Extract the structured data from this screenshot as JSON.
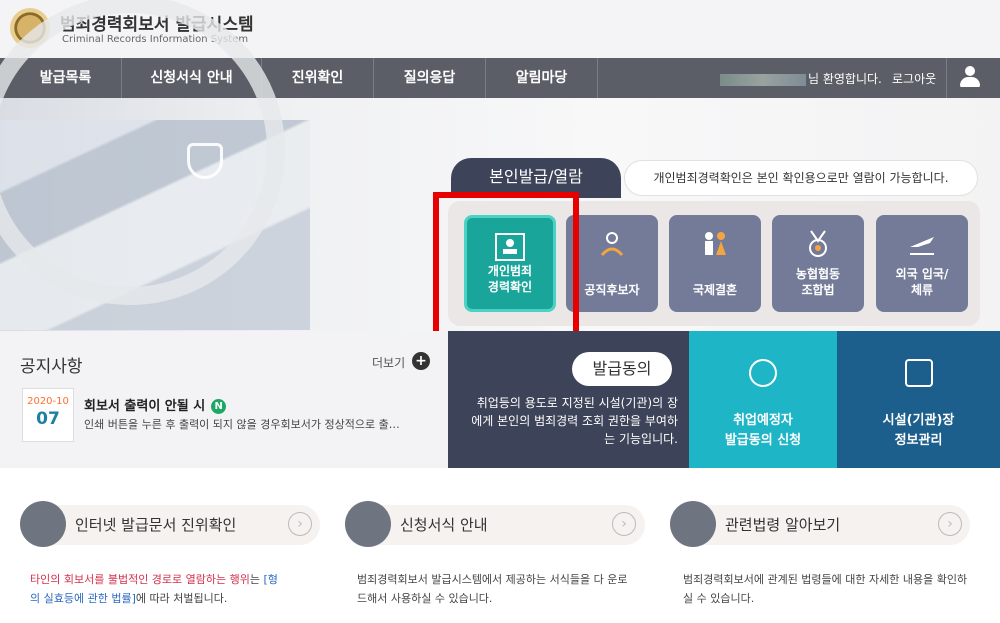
{
  "header": {
    "title": "범죄경력회보서 발급시스템",
    "subtitle": "Criminal Records Information System"
  },
  "nav": {
    "items": [
      "발급목록",
      "신청서식 안내",
      "진위확인",
      "질의응답",
      "알림마당"
    ],
    "welcome": "님 환영합니다.",
    "logout": "로그아웃"
  },
  "hero": {
    "tab_label": "본인발급/열람",
    "tab_desc": "개인범죄경력확인은 본인 확인용으로만 열람이 가능합니다.",
    "cards": [
      {
        "label1": "개인범죄",
        "label2": "경력확인"
      },
      {
        "label1": "공직후보자",
        "label2": ""
      },
      {
        "label1": "국제결혼",
        "label2": ""
      },
      {
        "label1": "농협협동",
        "label2": "조합법"
      },
      {
        "label1": "외국 입국/",
        "label2": "체류"
      }
    ]
  },
  "notice": {
    "title": "공지사항",
    "more": "더보기",
    "plus": "+",
    "date_ym": "2020-10",
    "date_day": "07",
    "item_title": "회보서 출력이 안될 시",
    "badge": "N",
    "item_text": "인쇄 버튼을 누른 후 출력이 되지 않을 경우회보서가 정상적으로 출…"
  },
  "consent": {
    "label": "발급동의",
    "desc": "취업등의 용도로 지정된 시설(기관)의 장에게 본인의 범죄경력 조회 권한을 부여하는 기능입니다."
  },
  "services": [
    {
      "line1": "취업예정자",
      "line2": "발급동의 신청"
    },
    {
      "line1": "시설(기관)장",
      "line2": "정보관리"
    }
  ],
  "links": [
    {
      "label": "인터넷 발급문서 진위확인"
    },
    {
      "label": "신청서식 안내"
    },
    {
      "label": "관련법령 알아보기"
    }
  ],
  "descs": {
    "d1a": "타인의 회보서를 불법적인 경로로 열람하는 행위",
    "d1b": "는 ",
    "d1c": "[형",
    "d1d": "의 실효등에 관한 법률]",
    "d1e": "에 따라 처벌됩니다.",
    "d2": "범죄경력회보서 발급시스템에서 제공하는 서식들을 다 운로드해서 사용하실 수 있습니다.",
    "d3": "범죄경력회보서에 관계된 법령들에 대한 자세한 내용을 확인하실 수 있습니다."
  },
  "colors": {
    "nav": "#5b5e66",
    "dark_panel": "#3d4358",
    "teal": "#1aa59b",
    "cyan": "#1eb5c7",
    "navy": "#1d5f8c",
    "highlight": "#e60000"
  }
}
